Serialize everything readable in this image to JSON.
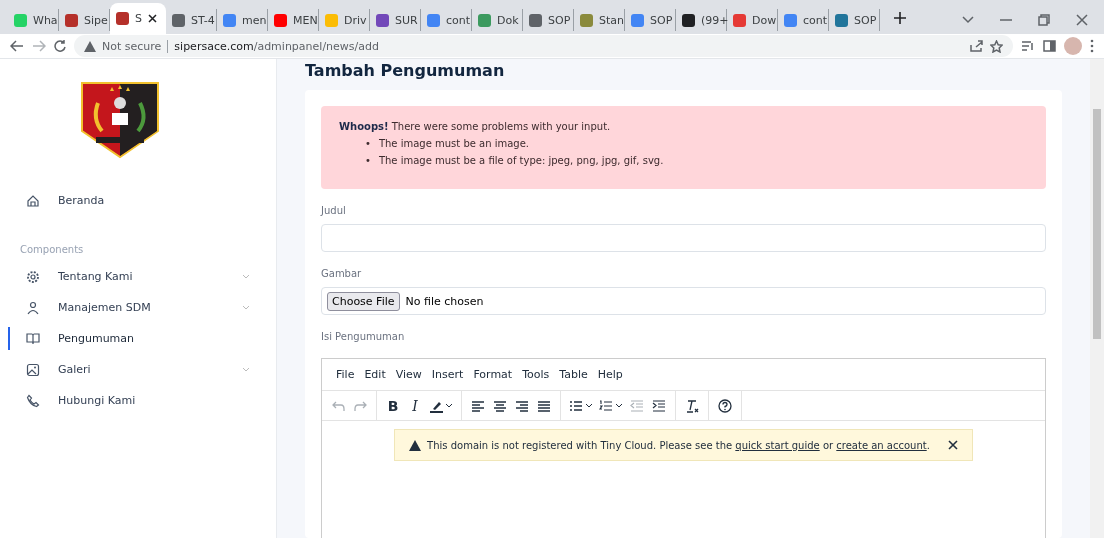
{
  "browser": {
    "tabs": [
      {
        "label": "Wha",
        "selected": false,
        "color": "#25d366"
      },
      {
        "label": "Sipe",
        "selected": false,
        "color": "#b5302a"
      },
      {
        "label": "S",
        "selected": true,
        "color": "#b5302a"
      },
      {
        "label": "ST-4",
        "selected": false,
        "color": "#5f6368"
      },
      {
        "label": "men",
        "selected": false,
        "color": "#4285f4"
      },
      {
        "label": "MEN",
        "selected": false,
        "color": "#ff0000"
      },
      {
        "label": "Driv",
        "selected": false,
        "color": "#fbbc04"
      },
      {
        "label": "SUR",
        "selected": false,
        "color": "#7248b9"
      },
      {
        "label": "cont",
        "selected": false,
        "color": "#4285f4"
      },
      {
        "label": "Dok",
        "selected": false,
        "color": "#3c9a5f"
      },
      {
        "label": "SOP",
        "selected": false,
        "color": "#5f6368"
      },
      {
        "label": "Stan",
        "selected": false,
        "color": "#8a8a3c"
      },
      {
        "label": "SOP",
        "selected": false,
        "color": "#4285f4"
      },
      {
        "label": "(99+",
        "selected": false,
        "color": "#202124"
      },
      {
        "label": "Dow",
        "selected": false,
        "color": "#e53935"
      },
      {
        "label": "cont",
        "selected": false,
        "color": "#4285f4"
      },
      {
        "label": "SOP",
        "selected": false,
        "color": "#21759b"
      }
    ],
    "security": "Not secure",
    "url_host": "sipersace.com",
    "url_path": "/adminpanel/news/add"
  },
  "sidebar": {
    "items_top": [
      {
        "label": "Beranda",
        "selected": false,
        "expandable": false
      }
    ],
    "section": "Components",
    "items": [
      {
        "label": "Tentang Kami",
        "selected": false,
        "expandable": true
      },
      {
        "label": "Manajemen SDM",
        "selected": false,
        "expandable": true
      },
      {
        "label": "Pengumuman",
        "selected": true,
        "expandable": false
      },
      {
        "label": "Galeri",
        "selected": false,
        "expandable": true
      },
      {
        "label": "Hubungi Kami",
        "selected": false,
        "expandable": false
      }
    ]
  },
  "page_title": "Tambah Pengumuman",
  "alert": {
    "lead": "Whoops!",
    "message": "There were some problems with your input.",
    "bullet": "•",
    "errors": [
      "The image must be an image.",
      "The image must be a file of type: jpeg, png, jpg, gif, svg."
    ]
  },
  "form": {
    "title_label": "Judul",
    "image_label": "Gambar",
    "file_button": "Choose File",
    "file_status": "No file chosen",
    "content_label": "Isi Pengumuman"
  },
  "editor": {
    "menu": [
      "File",
      "Edit",
      "View",
      "Insert",
      "Format",
      "Tools",
      "Table",
      "Help"
    ],
    "toolbar": [
      [
        {
          "disabled": true,
          "dropdown": false
        },
        {
          "disabled": true,
          "dropdown": false
        }
      ],
      [
        {
          "label": "B",
          "disabled": false,
          "dropdown": false
        },
        {
          "label": "I",
          "disabled": false,
          "dropdown": false
        },
        {
          "disabled": false,
          "dropdown": true
        }
      ],
      [
        {
          "disabled": false,
          "dropdown": false
        },
        {
          "disabled": false,
          "dropdown": false
        },
        {
          "disabled": false,
          "dropdown": false
        },
        {
          "disabled": false,
          "dropdown": false
        }
      ],
      [
        {
          "disabled": false,
          "dropdown": true
        },
        {
          "disabled": false,
          "dropdown": true
        },
        {
          "disabled": true,
          "dropdown": false
        },
        {
          "disabled": false,
          "dropdown": false
        }
      ],
      [
        {
          "disabled": false,
          "dropdown": false
        }
      ],
      [
        {
          "disabled": false,
          "dropdown": false
        }
      ]
    ],
    "notice": {
      "text_before": "This domain is not registered with Tiny Cloud. Please see the ",
      "link1": "quick start guide",
      "text_middle": " or ",
      "link2": "create an account",
      "text_after": "."
    }
  }
}
